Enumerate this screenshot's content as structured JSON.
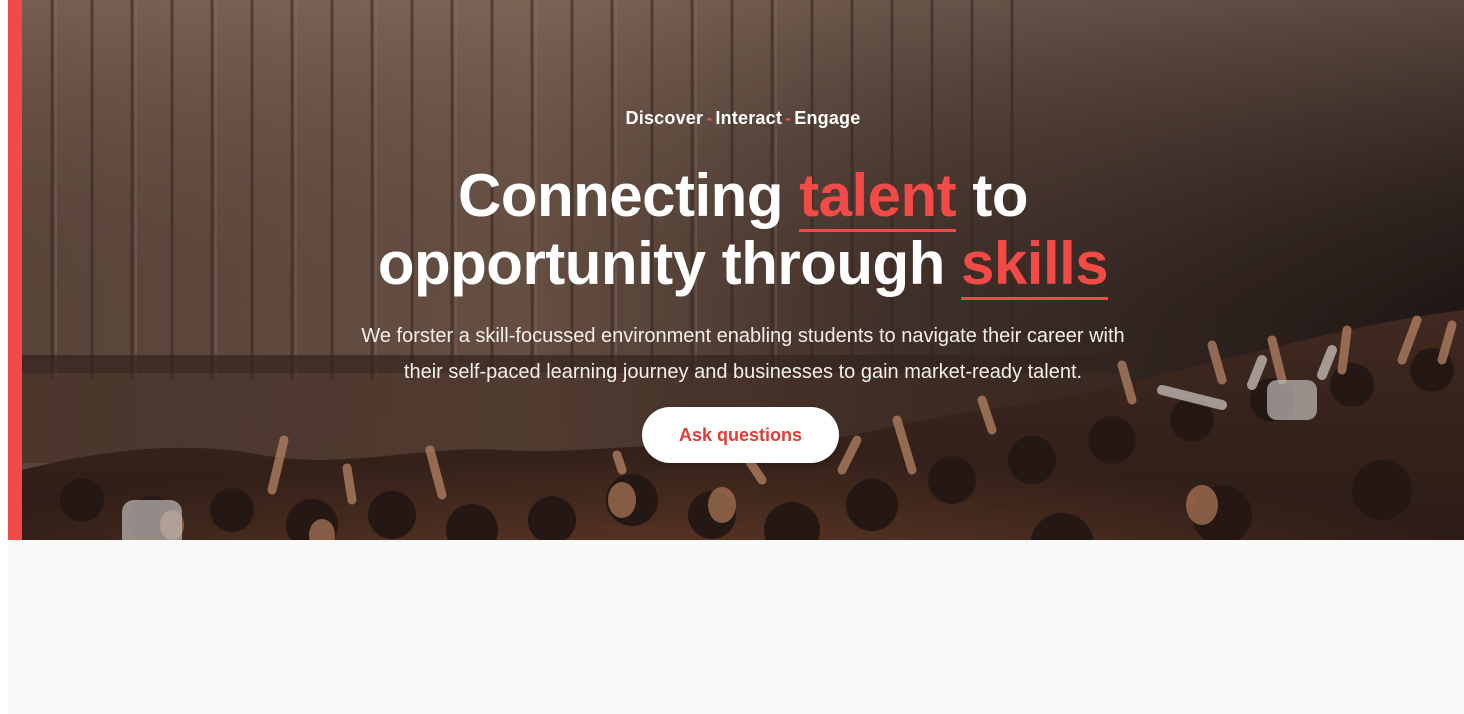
{
  "colors": {
    "accent": "#f24a46",
    "hero_overlay": "#3a2b24",
    "lower_background": "#f9f9f9",
    "button_background": "#ffffff",
    "button_text": "#e53935"
  },
  "hero": {
    "tagline": {
      "items": [
        "Discover",
        "Interact",
        "Engage"
      ],
      "separator": "-"
    },
    "headline": {
      "line1_before": "Connecting ",
      "line1_highlight": "talent",
      "line1_after": " to",
      "line2_before": "opportunity through ",
      "line2_highlight": "skills"
    },
    "subtext_line1": "We forster a skill-focussed environment enabling students to navigate their career with",
    "subtext_line2": "their self-paced learning journey and businesses to gain market-ready talent.",
    "cta_label": "Ask questions",
    "background_image": "concert-crowd-raising-hands-photo"
  }
}
